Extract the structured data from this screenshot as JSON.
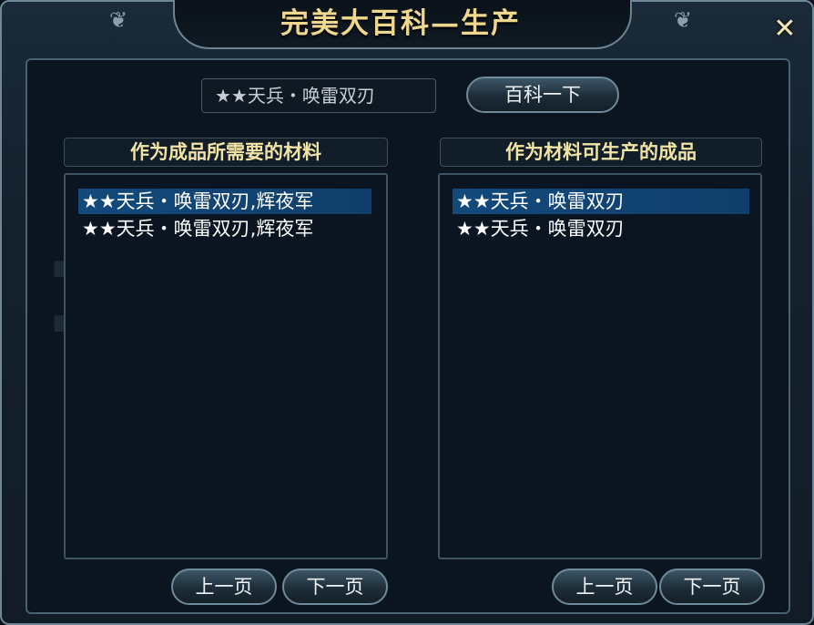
{
  "window": {
    "title": "完美大百科—生产",
    "close_glyph": "✕"
  },
  "search": {
    "value": "★★天兵・唤雷双刃",
    "button_label": "百科一下"
  },
  "left_panel": {
    "header": "作为成品所需要的材料",
    "items": [
      {
        "label": "★★天兵・唤雷双刃,辉夜军",
        "selected": true
      },
      {
        "label": "★★天兵・唤雷双刃,辉夜军",
        "selected": false
      }
    ],
    "prev_label": "上一页",
    "next_label": "下一页"
  },
  "right_panel": {
    "header": "作为材料可生产的成品",
    "items": [
      {
        "label": "★★天兵・唤雷双刃",
        "selected": true
      },
      {
        "label": "★★天兵・唤雷双刃",
        "selected": false
      }
    ],
    "prev_label": "上一页",
    "next_label": "下一页"
  },
  "colors": {
    "title_gold": "#f0d78e",
    "header_gold": "#f2e4a4",
    "selection_blue": "#134a7c"
  }
}
